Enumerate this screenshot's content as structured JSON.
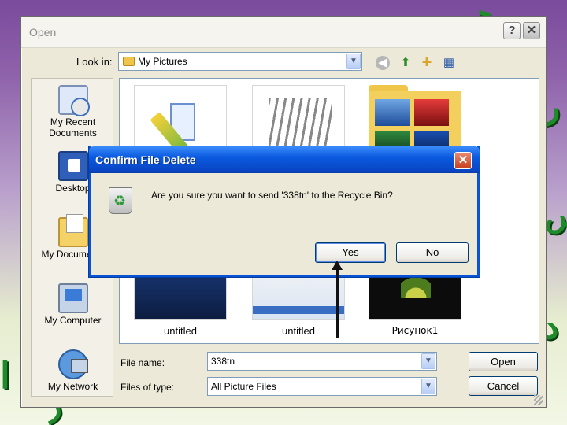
{
  "open_dialog": {
    "title": "Open",
    "help_glyph": "?",
    "close_glyph": "✕",
    "look_in_label": "Look in:",
    "look_in_value": "My Pictures",
    "places": [
      {
        "label": "My Recent Documents"
      },
      {
        "label": "Desktop"
      },
      {
        "label": "My Documents"
      },
      {
        "label": "My Computer"
      },
      {
        "label": "My Network"
      }
    ],
    "files": [
      "untitled",
      "untitled",
      "Рисунок1"
    ],
    "file_name_label": "File name:",
    "file_name_value": "338tn",
    "file_type_label": "Files of type:",
    "file_type_value": "All Picture Files",
    "open_button": "Open",
    "cancel_button": "Cancel"
  },
  "confirm_dialog": {
    "title": "Confirm File Delete",
    "close_glyph": "✕",
    "message": "Are you sure you want to send '338tn' to the Recycle Bin?",
    "yes_button": "Yes",
    "no_button": "No"
  },
  "icons": {
    "arrow_down": "▼",
    "back": "◀",
    "up": "⬆",
    "new_folder": "✚",
    "views": "▦"
  },
  "colors": {
    "xp_blue_title": "#0b5ae0",
    "dialog_bg": "#ece9d8",
    "close_red": "#c8401e"
  }
}
